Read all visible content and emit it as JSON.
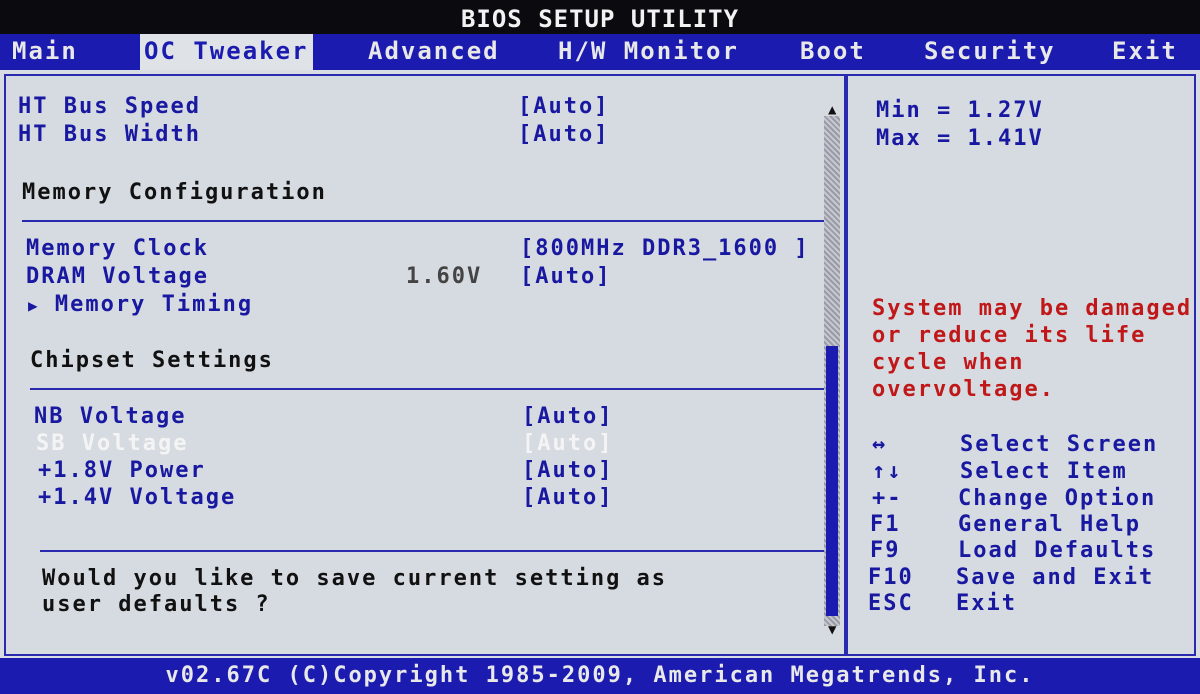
{
  "title": "BIOS SETUP UTILITY",
  "menu": {
    "main": "Main",
    "oc_tweaker": "OC Tweaker",
    "advanced": "Advanced",
    "hw_monitor": "H/W Monitor",
    "boot": "Boot",
    "security": "Security",
    "exit": "Exit"
  },
  "settings": {
    "ht_bus_speed": {
      "label": "HT Bus Speed",
      "value": "[Auto]"
    },
    "ht_bus_width": {
      "label": "HT Bus Width",
      "value": "[Auto]"
    },
    "memory_config_heading": "Memory Configuration",
    "memory_clock": {
      "label": "Memory Clock",
      "value": "[800MHz DDR3_1600 ]"
    },
    "dram_voltage": {
      "label": "DRAM Voltage",
      "current": "1.60V",
      "value": "[Auto]"
    },
    "memory_timing": {
      "label": "Memory Timing",
      "arrow": "▶"
    },
    "chipset_heading": "Chipset Settings",
    "nb_voltage": {
      "label": "NB Voltage",
      "value": "[Auto]"
    },
    "sb_voltage": {
      "label": "SB Voltage",
      "value": "[Auto]"
    },
    "power_18v": {
      "label": "+1.8V Power",
      "value": "[Auto]"
    },
    "voltage_14v": {
      "label": "+1.4V Voltage",
      "value": "[Auto]"
    }
  },
  "prompt": {
    "line1": "Would you like to save current setting as",
    "line2": "user defaults ?"
  },
  "help": {
    "min": "Min   = 1.27V",
    "max": "Max   = 1.41V",
    "warning_lines": [
      "System may be damaged",
      "or reduce its life",
      "cycle  when",
      "overvoltage."
    ]
  },
  "keys": [
    {
      "key": "↔",
      "action": "Select Screen"
    },
    {
      "key": "↑↓",
      "action": "Select Item"
    },
    {
      "key": "+-",
      "action": "Change Option"
    },
    {
      "key": "F1",
      "action": "General Help"
    },
    {
      "key": "F9",
      "action": "Load Defaults"
    },
    {
      "key": "F10",
      "action": "Save and Exit"
    },
    {
      "key": "ESC",
      "action": "Exit"
    }
  ],
  "footer": "v02.67C (C)Copyright 1985-2009, American Megatrends, Inc.",
  "colors": {
    "accent": "#1b1bb0",
    "background": "#d8dde3",
    "warning": "#c01818",
    "highlight": "#f4f4f4"
  }
}
